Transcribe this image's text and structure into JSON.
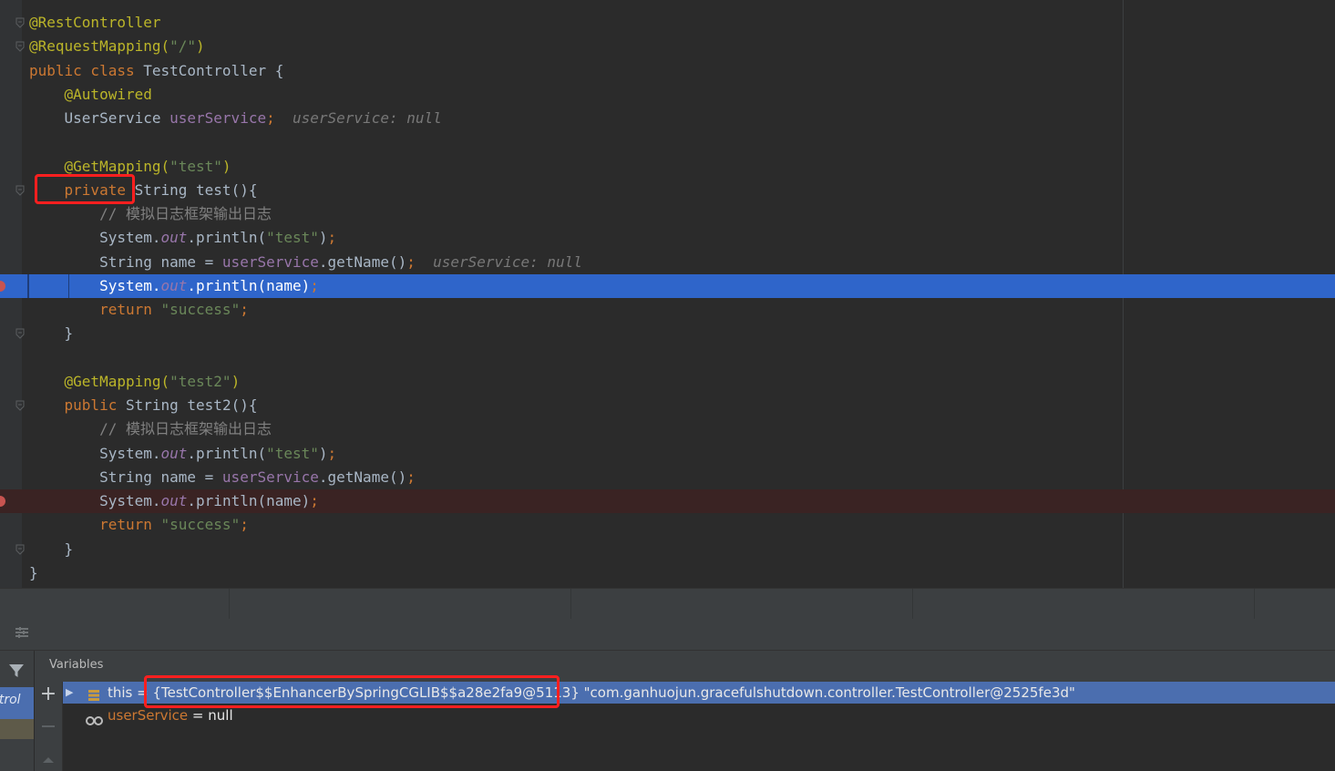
{
  "editor": {
    "lines": [
      {
        "tokens": [
          {
            "t": "@RestController",
            "c": "t-ann"
          }
        ]
      },
      {
        "tokens": [
          {
            "t": "@RequestMapping(",
            "c": "t-ann"
          },
          {
            "t": "\"/\"",
            "c": "t-str"
          },
          {
            "t": ")",
            "c": "t-ann"
          }
        ]
      },
      {
        "tokens": [
          {
            "t": "public class ",
            "c": "t-kw"
          },
          {
            "t": "TestController ",
            "c": "t-decl"
          },
          {
            "t": "{",
            "c": "t-plain"
          }
        ]
      },
      {
        "tokens": [
          {
            "t": "    "
          },
          {
            "t": "@Autowired",
            "c": "t-ann"
          }
        ]
      },
      {
        "tokens": [
          {
            "t": "    UserService ",
            "c": "t-plain"
          },
          {
            "t": "userService",
            "c": "t-field"
          },
          {
            "t": ";",
            "c": "t-kw"
          },
          {
            "t": "  userService: null",
            "c": "t-inline"
          }
        ]
      },
      {
        "tokens": [
          {
            "t": ""
          }
        ]
      },
      {
        "tokens": [
          {
            "t": "    "
          },
          {
            "t": "@GetMapping(",
            "c": "t-ann"
          },
          {
            "t": "\"test\"",
            "c": "t-str"
          },
          {
            "t": ")",
            "c": "t-ann"
          }
        ]
      },
      {
        "tokens": [
          {
            "t": "    "
          },
          {
            "t": "private ",
            "c": "t-kw"
          },
          {
            "t": "String ",
            "c": "t-plain"
          },
          {
            "t": "test",
            "c": "t-decl"
          },
          {
            "t": "(){",
            "c": "t-plain"
          }
        ]
      },
      {
        "tokens": [
          {
            "t": "        // 模拟日志框架输出日志",
            "c": "t-cmt"
          }
        ]
      },
      {
        "tokens": [
          {
            "t": "        System.",
            "c": "t-plain"
          },
          {
            "t": "out",
            "c": "t-static"
          },
          {
            "t": ".println(",
            "c": "t-plain"
          },
          {
            "t": "\"test\"",
            "c": "t-str"
          },
          {
            "t": ")",
            "c": "t-plain"
          },
          {
            "t": ";",
            "c": "t-kw"
          }
        ]
      },
      {
        "tokens": [
          {
            "t": "        String name = ",
            "c": "t-plain"
          },
          {
            "t": "userService",
            "c": "t-field"
          },
          {
            "t": ".getName()",
            "c": "t-plain"
          },
          {
            "t": ";",
            "c": "t-kw"
          },
          {
            "t": "  userService: null",
            "c": "t-inline"
          }
        ]
      },
      {
        "tokens": [
          {
            "t": "        System.",
            "c": "t-plain"
          },
          {
            "t": "out",
            "c": "t-static"
          },
          {
            "t": ".println(name)",
            "c": "t-plain"
          },
          {
            "t": ";",
            "c": "t-kw"
          }
        ]
      },
      {
        "tokens": [
          {
            "t": "        "
          },
          {
            "t": "return ",
            "c": "t-kw"
          },
          {
            "t": "\"success\"",
            "c": "t-str"
          },
          {
            "t": ";",
            "c": "t-kw"
          }
        ]
      },
      {
        "tokens": [
          {
            "t": "    }",
            "c": "t-plain"
          }
        ]
      },
      {
        "tokens": [
          {
            "t": ""
          }
        ]
      },
      {
        "tokens": [
          {
            "t": "    "
          },
          {
            "t": "@GetMapping(",
            "c": "t-ann"
          },
          {
            "t": "\"test2\"",
            "c": "t-str"
          },
          {
            "t": ")",
            "c": "t-ann"
          }
        ]
      },
      {
        "tokens": [
          {
            "t": "    "
          },
          {
            "t": "public ",
            "c": "t-kw"
          },
          {
            "t": "String ",
            "c": "t-plain"
          },
          {
            "t": "test2",
            "c": "t-decl"
          },
          {
            "t": "(){",
            "c": "t-plain"
          }
        ]
      },
      {
        "tokens": [
          {
            "t": "        // 模拟日志框架输出日志",
            "c": "t-cmt"
          }
        ]
      },
      {
        "tokens": [
          {
            "t": "        System.",
            "c": "t-plain"
          },
          {
            "t": "out",
            "c": "t-static"
          },
          {
            "t": ".println(",
            "c": "t-plain"
          },
          {
            "t": "\"test\"",
            "c": "t-str"
          },
          {
            "t": ")",
            "c": "t-plain"
          },
          {
            "t": ";",
            "c": "t-kw"
          }
        ]
      },
      {
        "tokens": [
          {
            "t": "        String name = ",
            "c": "t-plain"
          },
          {
            "t": "userService",
            "c": "t-field"
          },
          {
            "t": ".getName()",
            "c": "t-plain"
          },
          {
            "t": ";",
            "c": "t-kw"
          }
        ]
      },
      {
        "tokens": [
          {
            "t": "        System.",
            "c": "t-plain"
          },
          {
            "t": "out",
            "c": "t-static"
          },
          {
            "t": ".println(name)",
            "c": "t-plain"
          },
          {
            "t": ";",
            "c": "t-kw"
          }
        ]
      },
      {
        "tokens": [
          {
            "t": "        "
          },
          {
            "t": "return ",
            "c": "t-kw"
          },
          {
            "t": "\"success\"",
            "c": "t-str"
          },
          {
            "t": ";",
            "c": "t-kw"
          }
        ]
      },
      {
        "tokens": [
          {
            "t": "    }",
            "c": "t-plain"
          }
        ]
      },
      {
        "tokens": [
          {
            "t": "}",
            "c": "t-plain"
          }
        ]
      }
    ],
    "execution_line": 11,
    "breakpoint_lines": [
      11,
      20
    ]
  },
  "debug": {
    "variables_title": "Variables",
    "frames_label": "ntrol",
    "variables": [
      {
        "name": "this",
        "op": " = ",
        "value": "{TestController$$EnhancerBySpringCGLIB$$a28e2fa9@5113}",
        "extra": " \"com.ganhuojun.gracefulshutdown.controller.TestController@2525fe3d\"",
        "icon": "object-icon",
        "expand": true,
        "selected": true
      },
      {
        "name": "userService",
        "op": " = ",
        "value": "null",
        "extra": "",
        "icon": "field-watch-icon",
        "expand": false,
        "selected": false
      }
    ]
  },
  "colors": {
    "execution_line": "#2f65ca",
    "breakpoint": "#c75450",
    "highlight_box": "#ff1f1f"
  }
}
